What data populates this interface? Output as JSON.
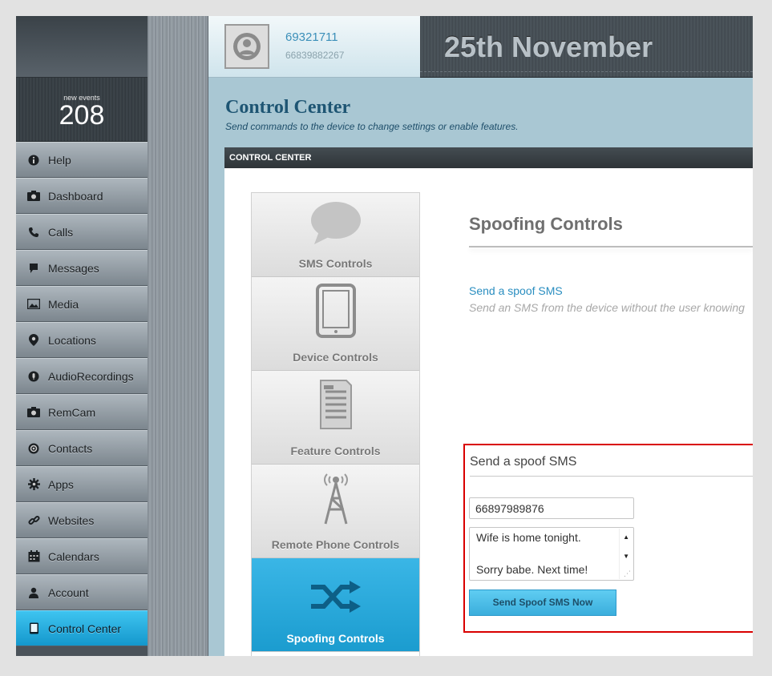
{
  "sidebar": {
    "events_label": "new events",
    "events_count": "208",
    "items": [
      {
        "label": "Help",
        "icon": "info-icon"
      },
      {
        "label": "Dashboard",
        "icon": "camera-icon"
      },
      {
        "label": "Calls",
        "icon": "phone-icon"
      },
      {
        "label": "Messages",
        "icon": "message-icon"
      },
      {
        "label": "Media",
        "icon": "image-icon"
      },
      {
        "label": "Locations",
        "icon": "location-pin-icon"
      },
      {
        "label": "AudioRecordings",
        "icon": "microphone-icon"
      },
      {
        "label": "RemCam",
        "icon": "camera-icon"
      },
      {
        "label": "Contacts",
        "icon": "contacts-icon"
      },
      {
        "label": "Apps",
        "icon": "gear-icon"
      },
      {
        "label": "Websites",
        "icon": "link-icon"
      },
      {
        "label": "Calendars",
        "icon": "calendar-icon"
      },
      {
        "label": "Account",
        "icon": "user-icon"
      },
      {
        "label": "Control Center",
        "icon": "tablet-icon"
      }
    ],
    "active_item": "Control Center",
    "active_color": "#1fa6dc"
  },
  "header": {
    "phone_primary": "69321711",
    "phone_secondary": "66839882267",
    "date": "25th November"
  },
  "page": {
    "title": "Control Center",
    "subtitle": "Send commands to the device to change settings or enable features.",
    "panel_label": "CONTROL CENTER"
  },
  "tabs": [
    {
      "label": "SMS Controls",
      "icon": "speech-bubble-icon"
    },
    {
      "label": "Device Controls",
      "icon": "tablet-icon"
    },
    {
      "label": "Feature Controls",
      "icon": "document-icon"
    },
    {
      "label": "Remote Phone Controls",
      "icon": "antenna-icon"
    },
    {
      "label": "Spoofing Controls",
      "icon": "shuffle-icon"
    }
  ],
  "main": {
    "section_title": "Spoofing Controls",
    "link_text": "Send a spoof SMS",
    "link_desc": "Send an SMS from the device without the user knowing",
    "form_title": "Send a spoof SMS",
    "phone_value": "66897989876",
    "message_line1": "Wife is home tonight.",
    "message_line2": "Sorry babe.  Next time!",
    "send_button": "Send Spoof SMS Now",
    "highlight_color": "#d90000"
  }
}
